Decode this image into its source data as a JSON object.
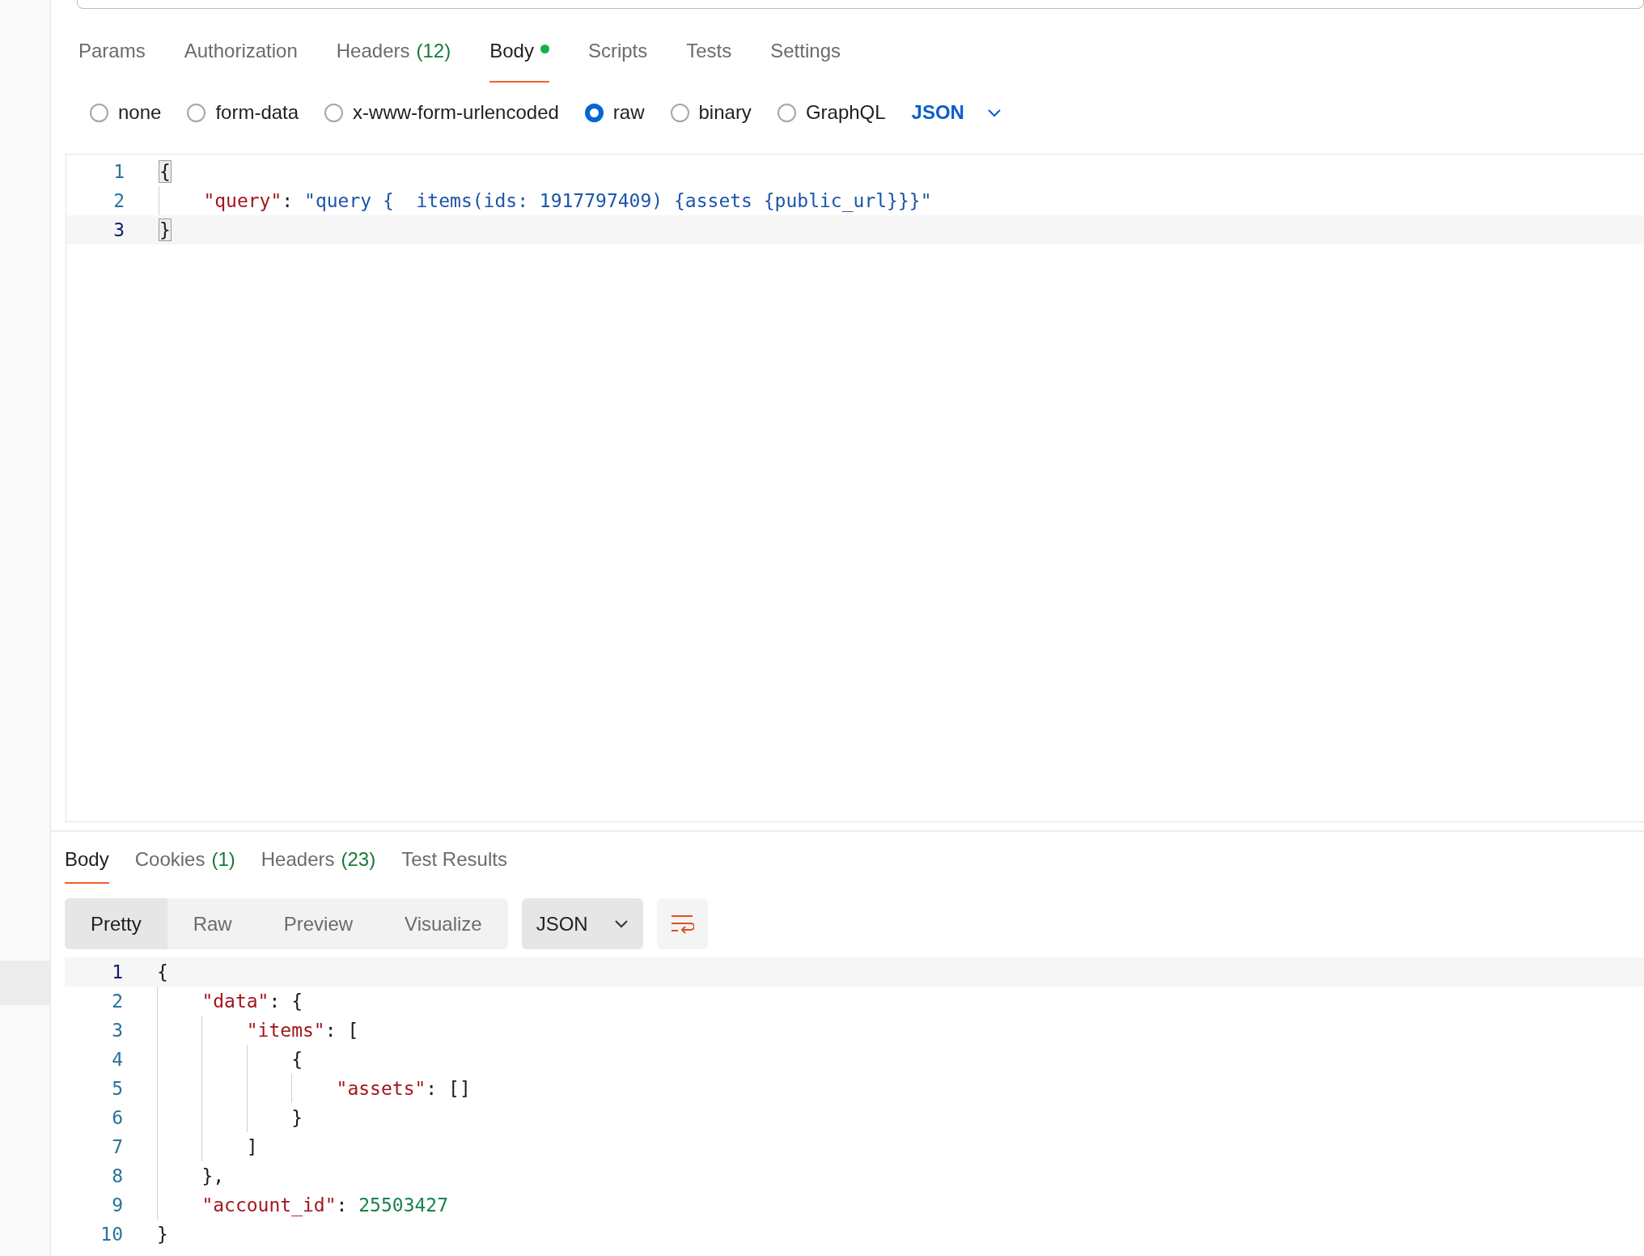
{
  "request_tabs": [
    {
      "label": "Params",
      "selected": false,
      "modified": false
    },
    {
      "label": "Authorization",
      "selected": false,
      "modified": false
    },
    {
      "label": "Headers",
      "count": "(12)",
      "selected": false,
      "modified": false
    },
    {
      "label": "Body",
      "selected": true,
      "modified": true
    },
    {
      "label": "Scripts",
      "selected": false,
      "modified": false
    },
    {
      "label": "Tests",
      "selected": false,
      "modified": false
    },
    {
      "label": "Settings",
      "selected": false,
      "modified": false
    }
  ],
  "body_types": [
    {
      "label": "none",
      "selected": false
    },
    {
      "label": "form-data",
      "selected": false
    },
    {
      "label": "x-www-form-urlencoded",
      "selected": false
    },
    {
      "label": "raw",
      "selected": true
    },
    {
      "label": "binary",
      "selected": false
    },
    {
      "label": "GraphQL",
      "selected": false
    }
  ],
  "body_format": {
    "label": "JSON"
  },
  "request_body": {
    "lines": [
      {
        "number": "1",
        "active": false,
        "tokens": [
          {
            "kind": "punct",
            "text": "{",
            "matched": true
          }
        ]
      },
      {
        "number": "2",
        "active": false,
        "tokens": [
          {
            "kind": "key",
            "text": "    \"query\""
          },
          {
            "kind": "punct",
            "text": ": "
          },
          {
            "kind": "string",
            "text": "\"query {  items(ids: 1917797409) {assets {public_url}}}\""
          }
        ]
      },
      {
        "number": "3",
        "active": true,
        "tokens": [
          {
            "kind": "punct",
            "text": "}",
            "matched": true
          }
        ]
      }
    ]
  },
  "response_tabs": [
    {
      "label": "Body",
      "selected": true
    },
    {
      "label": "Cookies",
      "count": "(1)",
      "selected": false
    },
    {
      "label": "Headers",
      "count": "(23)",
      "selected": false
    },
    {
      "label": "Test Results",
      "selected": false
    }
  ],
  "view_modes": [
    {
      "label": "Pretty",
      "selected": true
    },
    {
      "label": "Raw",
      "selected": false
    },
    {
      "label": "Preview",
      "selected": false
    },
    {
      "label": "Visualize",
      "selected": false
    }
  ],
  "response_format": {
    "label": "JSON"
  },
  "response_body": {
    "lines": [
      {
        "number": "1",
        "active": true,
        "tokens": [
          {
            "kind": "punct",
            "text": "{"
          }
        ]
      },
      {
        "number": "2",
        "active": false,
        "tokens": [
          {
            "kind": "key",
            "text": "    \"data\""
          },
          {
            "kind": "punct",
            "text": ": {"
          }
        ]
      },
      {
        "number": "3",
        "active": false,
        "tokens": [
          {
            "kind": "key",
            "text": "        \"items\""
          },
          {
            "kind": "punct",
            "text": ": ["
          }
        ]
      },
      {
        "number": "4",
        "active": false,
        "tokens": [
          {
            "kind": "punct",
            "text": "            {"
          }
        ]
      },
      {
        "number": "5",
        "active": false,
        "tokens": [
          {
            "kind": "key",
            "text": "                \"assets\""
          },
          {
            "kind": "punct",
            "text": ": []"
          }
        ]
      },
      {
        "number": "6",
        "active": false,
        "tokens": [
          {
            "kind": "punct",
            "text": "            }"
          }
        ]
      },
      {
        "number": "7",
        "active": false,
        "tokens": [
          {
            "kind": "punct",
            "text": "        ]"
          }
        ]
      },
      {
        "number": "8",
        "active": false,
        "tokens": [
          {
            "kind": "punct",
            "text": "    },"
          }
        ]
      },
      {
        "number": "9",
        "active": false,
        "tokens": [
          {
            "kind": "key",
            "text": "    \"account_id\""
          },
          {
            "kind": "punct",
            "text": ": "
          },
          {
            "kind": "number",
            "text": "25503427"
          }
        ]
      },
      {
        "number": "10",
        "active": false,
        "tokens": [
          {
            "kind": "punct",
            "text": "}"
          }
        ]
      }
    ]
  }
}
